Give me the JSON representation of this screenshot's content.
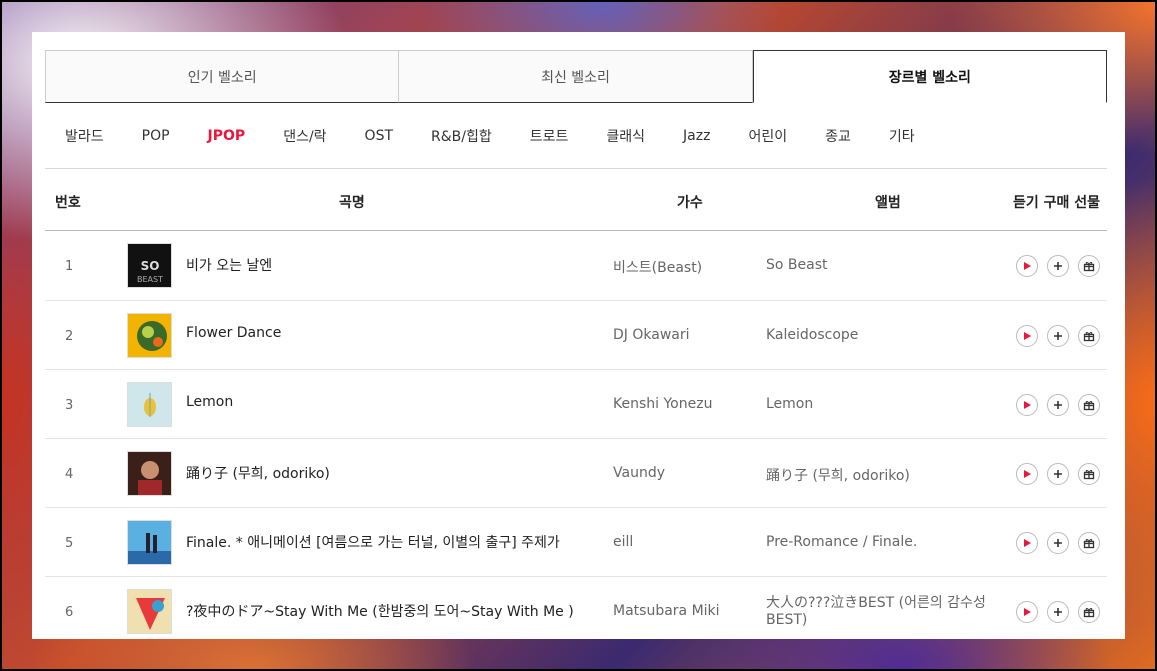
{
  "tabs": [
    {
      "label": "인기 벨소리",
      "active": false
    },
    {
      "label": "최신 벨소리",
      "active": false
    },
    {
      "label": "장르별 벨소리",
      "active": true
    }
  ],
  "genres": [
    "발라드",
    "POP",
    "JPOP",
    "댄스/락",
    "OST",
    "R&B/힙합",
    "트로트",
    "클래식",
    "Jazz",
    "어린이",
    "종교",
    "기타"
  ],
  "active_genre": "JPOP",
  "accent_color": "#e8173b",
  "columns": {
    "num": "번호",
    "title": "곡명",
    "artist": "가수",
    "album": "앨범",
    "actions": "듣기 구매 선물"
  },
  "rows": [
    {
      "num": "1",
      "title": "비가 오는 날엔",
      "artist": "비스트(Beast)",
      "album": "So Beast"
    },
    {
      "num": "2",
      "title": "Flower Dance",
      "artist": "DJ Okawari",
      "album": "Kaleidoscope"
    },
    {
      "num": "3",
      "title": "Lemon",
      "artist": "Kenshi Yonezu",
      "album": "Lemon"
    },
    {
      "num": "4",
      "title": "踊り子 (무희, odoriko)",
      "artist": "Vaundy",
      "album": "踊り子 (무희, odoriko)"
    },
    {
      "num": "5",
      "title": "Finale. * 애니메이션 [여름으로 가는 터널, 이별의 출구] 주제가",
      "artist": "eill",
      "album": "Pre-Romance / Finale."
    },
    {
      "num": "6",
      "title": "?夜中のドア~Stay With Me (한밤중의 도어~Stay With Me )",
      "artist": "Matsubara Miki",
      "album": "大人の???泣きBEST (어른의 감수성 BEST)"
    }
  ],
  "icons": {
    "play": "play-icon",
    "add": "plus-icon",
    "gift": "gift-icon"
  }
}
